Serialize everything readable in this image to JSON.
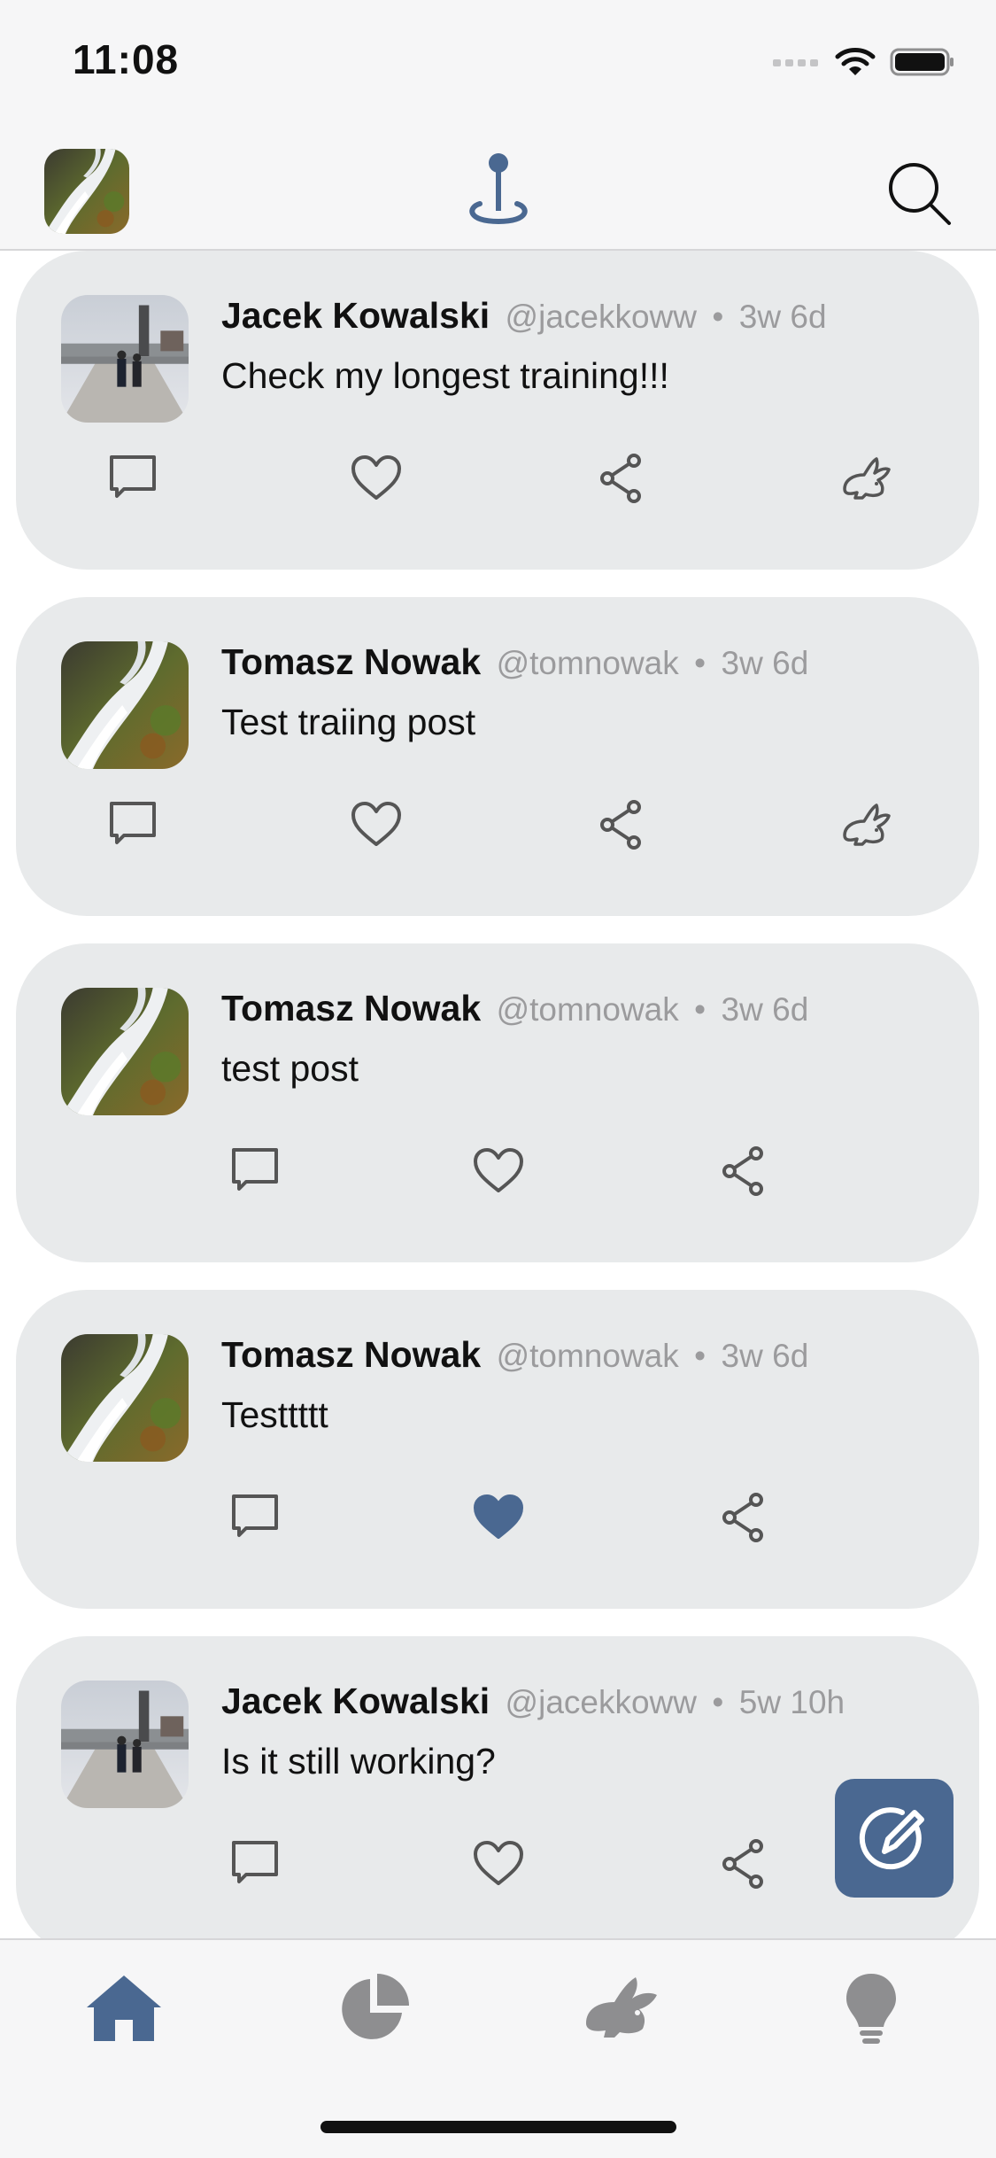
{
  "status_bar": {
    "time": "11:08",
    "icons": [
      "signal-icon",
      "wifi-icon",
      "battery-icon"
    ]
  },
  "top_nav": {
    "avatar": "user-avatar",
    "logo": "location-pin-icon",
    "search": "search-icon"
  },
  "posts": [
    {
      "name": "Jacek Kowalski",
      "handle": "@jacekkoww",
      "time": "3w 6d",
      "text": "Check my longest training!!!",
      "avatar": "bridge-photo",
      "liked": false,
      "has_training": true
    },
    {
      "name": "Tomasz Nowak",
      "handle": "@tomnowak",
      "time": "3w 6d",
      "text": "Test traiing post",
      "avatar": "waterfall-photo",
      "liked": false,
      "has_training": true
    },
    {
      "name": "Tomasz Nowak",
      "handle": "@tomnowak",
      "time": "3w 6d",
      "text": "test post",
      "avatar": "waterfall-photo",
      "liked": false,
      "has_training": false
    },
    {
      "name": "Tomasz Nowak",
      "handle": "@tomnowak",
      "time": "3w 6d",
      "text": "Testtttt",
      "avatar": "waterfall-photo",
      "liked": true,
      "has_training": false
    },
    {
      "name": "Jacek Kowalski",
      "handle": "@jacekkoww",
      "time": "5w 10h",
      "text": "Is it still working?",
      "avatar": "bridge-photo",
      "liked": false,
      "has_training": false
    }
  ],
  "tab_bar": {
    "tabs": [
      "home-icon",
      "pie-chart-icon",
      "rabbit-icon",
      "lightbulb-icon"
    ],
    "active": "home-icon"
  },
  "colors": {
    "accent": "#4a6891",
    "card_bg": "#e8eaeb",
    "icon_gray": "#555555",
    "meta_gray": "#9b9b9d"
  }
}
